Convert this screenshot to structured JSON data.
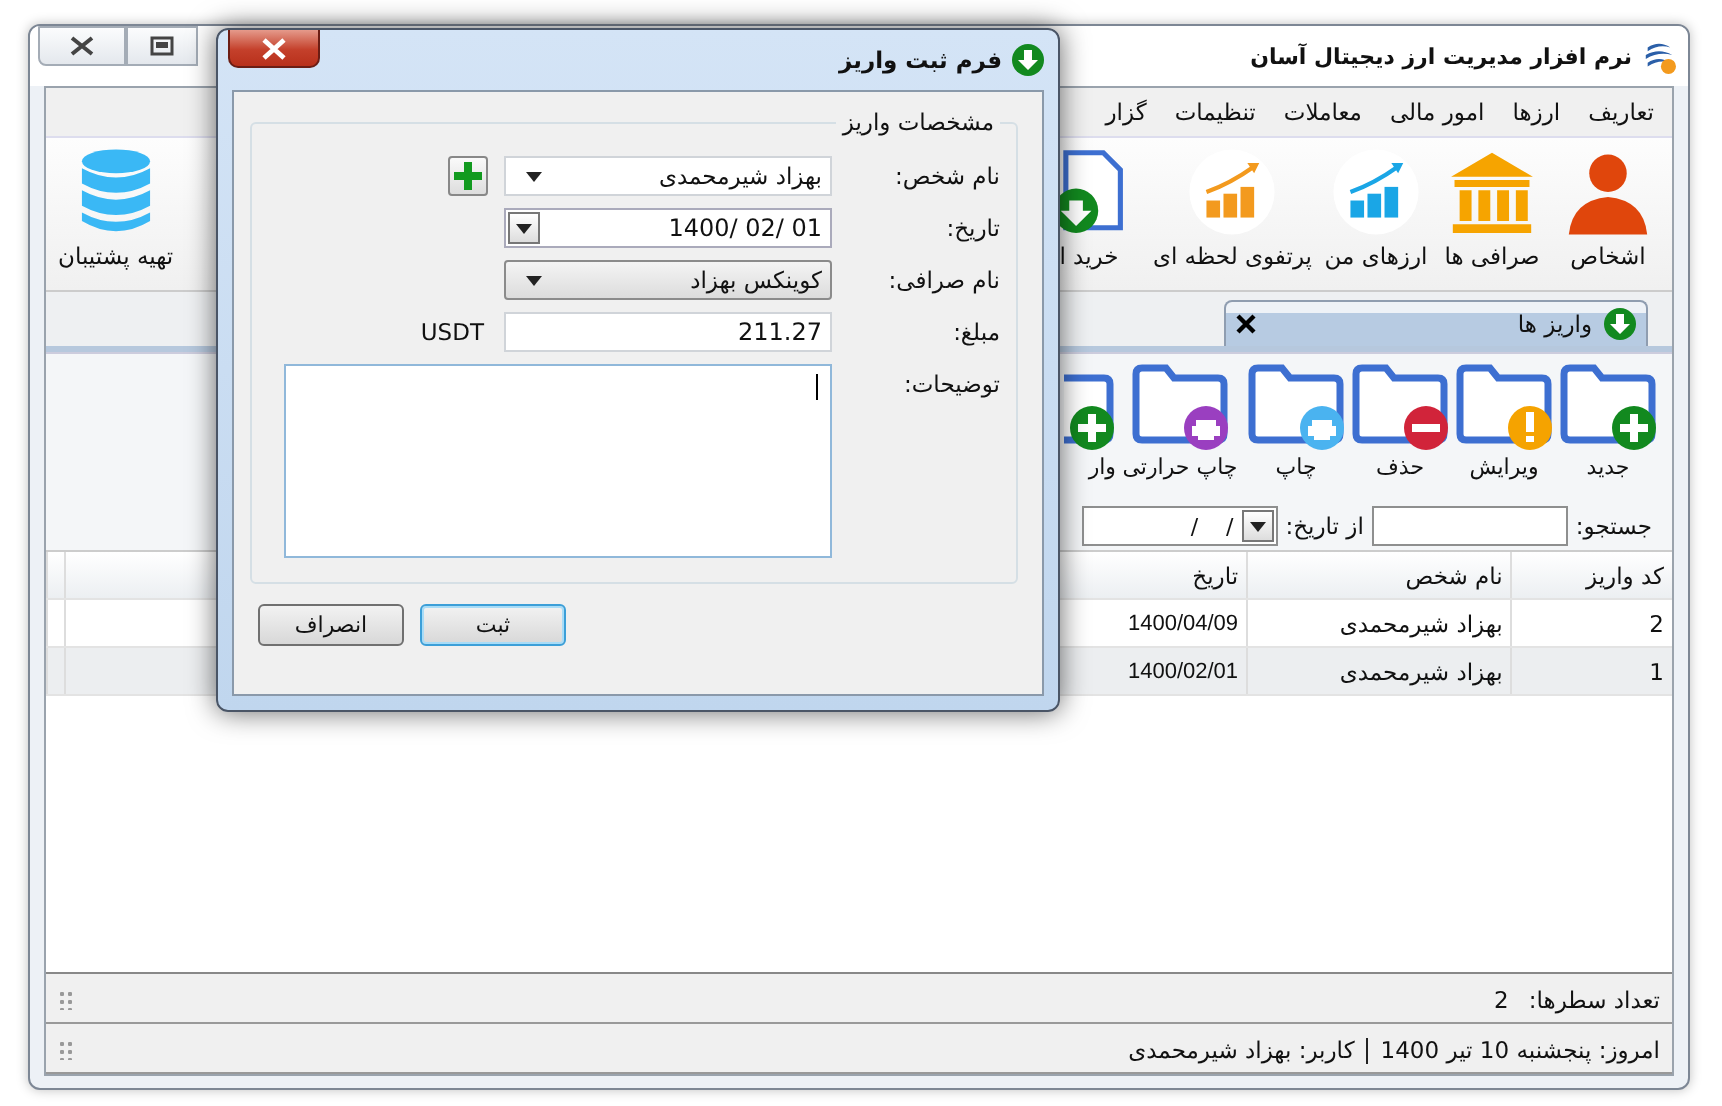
{
  "window": {
    "title": "نرم افزار مدیریت ارز دیجیتال آسان"
  },
  "menu": [
    "تعاریف",
    "ارزها",
    "امور مالی",
    "معاملات",
    "تنظیمات",
    "گزار"
  ],
  "ribbon": [
    {
      "label": "اشخاص",
      "kind": "person"
    },
    {
      "label": "صرافی ها",
      "kind": "bank"
    },
    {
      "label": "ارزهای من",
      "kind": "chartblue"
    },
    {
      "label": "پرتفوی لحظه ای",
      "kind": "chartorange"
    },
    {
      "label": "خرید ا",
      "kind": "buy"
    }
  ],
  "ribbon_left": [
    {
      "label": "تهیه پشتیبان",
      "kind": "backup"
    }
  ],
  "tabs": [
    {
      "label": "واریز ها",
      "selected": true
    }
  ],
  "toolbar": [
    {
      "label": "جدید",
      "kind": "add"
    },
    {
      "label": "ویرایش",
      "kind": "edit"
    },
    {
      "label": "حذف",
      "kind": "delete"
    },
    {
      "label": "چاپ",
      "kind": "print"
    },
    {
      "label": "چاپ حرارتی",
      "kind": "thermal"
    },
    {
      "label": "وار",
      "kind": "import"
    }
  ],
  "filter": {
    "search_label": "جستجو:",
    "from_date_label": "از تاریخ:",
    "from_date_value": "/    /"
  },
  "table": {
    "columns": [
      "کد واریز",
      "نام شخص",
      "تاریخ"
    ],
    "rows": [
      {
        "cells": [
          "2",
          "بهزاد شیرمحمدی",
          "1400/04/09"
        ]
      },
      {
        "cells": [
          "1",
          "بهزاد شیرمحمدی",
          "1400/02/01"
        ]
      }
    ]
  },
  "row_count": {
    "label": "تعداد سطرها:",
    "value": "2"
  },
  "status": {
    "today": "امروز: پنجشنبه 10 تیر 1400",
    "user": "کاربر: بهزاد شیرمحمدی"
  },
  "dialog": {
    "title": "فرم ثبت واریز",
    "group": "مشخصات واریز",
    "fields": [
      {
        "label": "نام شخص:",
        "kind": "combo",
        "value": "بهزاد شیرمحمدی",
        "add_button": true
      },
      {
        "label": "تاریخ:",
        "kind": "date",
        "value": "1400/ 02/ 01"
      },
      {
        "label": "نام صرافی:",
        "kind": "dropdown",
        "value": "کوینکس بهزاد"
      },
      {
        "label": "مبلغ:",
        "kind": "text",
        "value": "211.27",
        "unit": "USDT"
      },
      {
        "label": "توضیحات:",
        "kind": "memo"
      }
    ],
    "buttons": [
      {
        "label": "ثبت",
        "focused": true
      },
      {
        "label": "انصراف",
        "focused": false
      }
    ]
  }
}
